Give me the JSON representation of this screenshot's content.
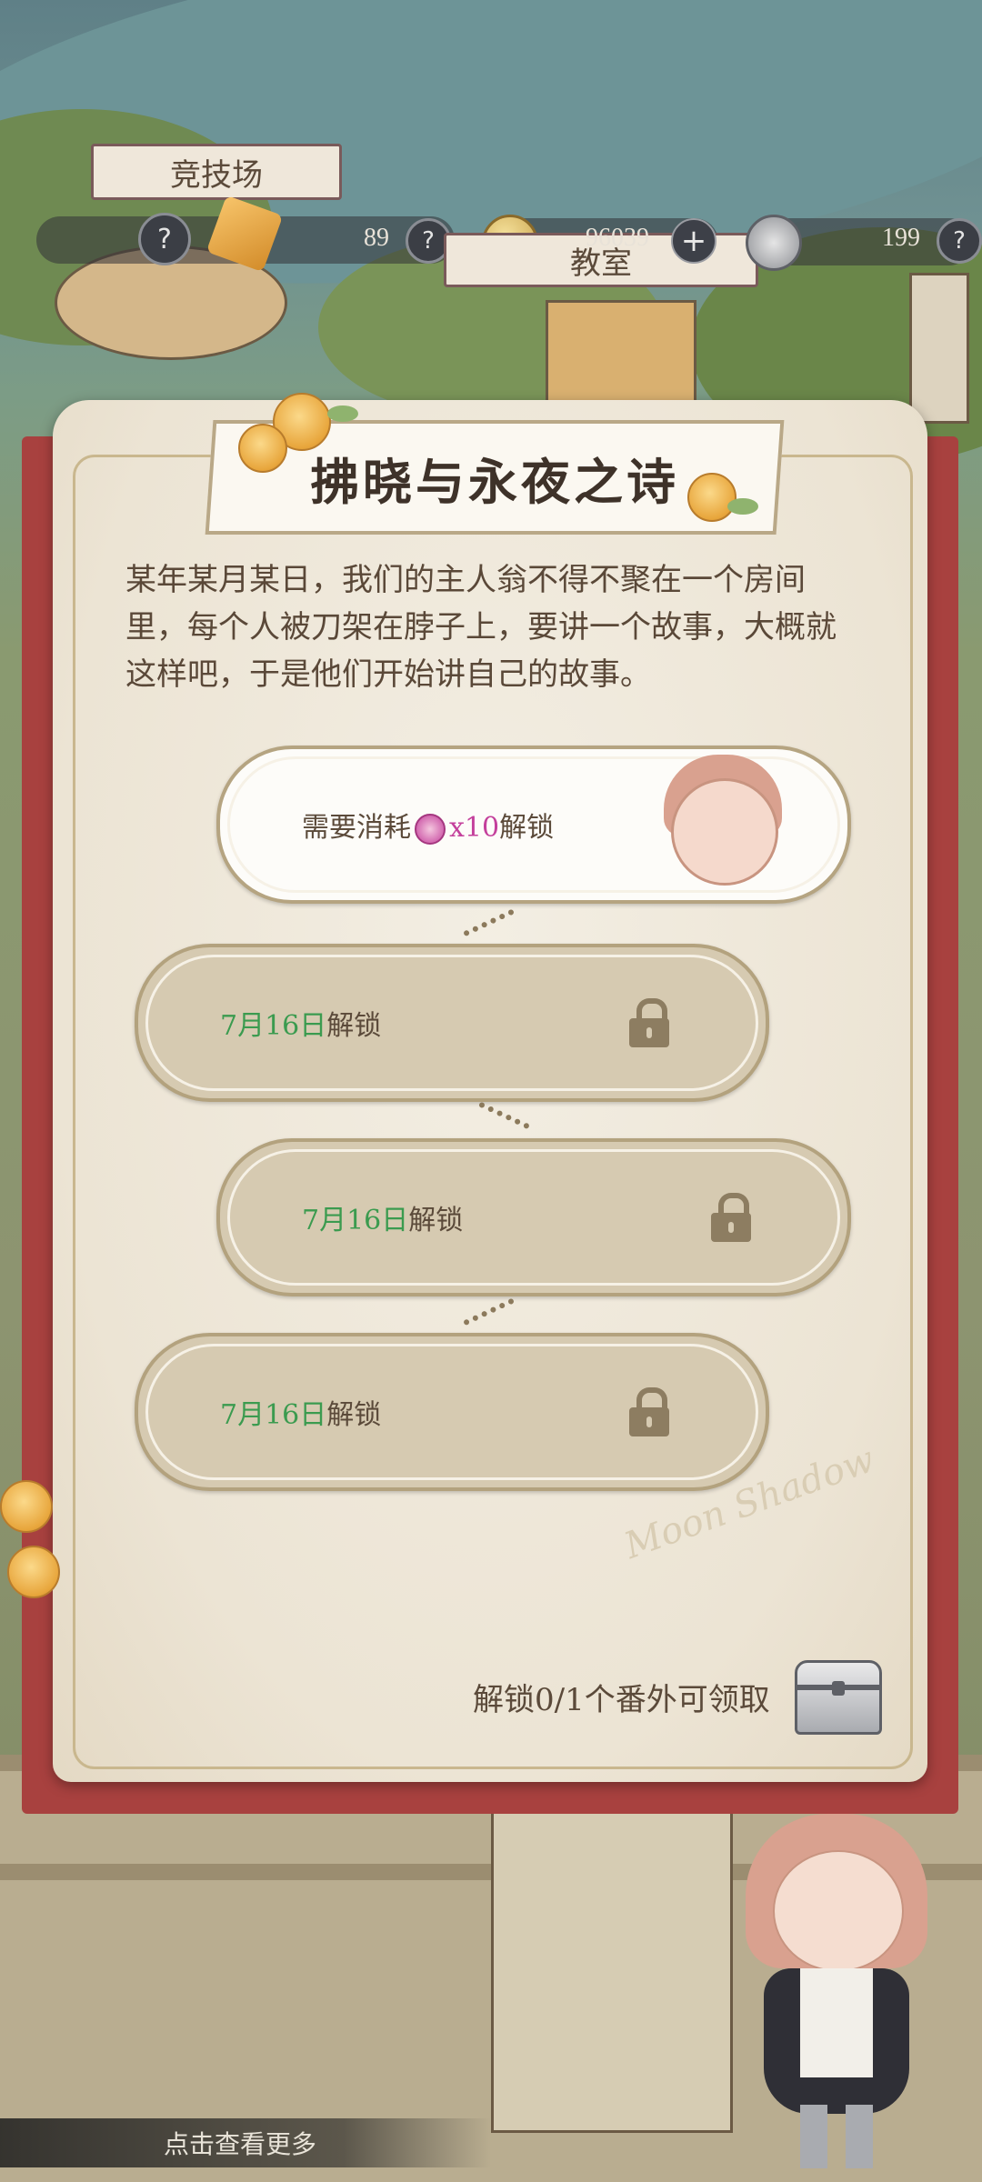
{
  "map": {
    "arena_label": "竞技场",
    "classroom_label": "教室"
  },
  "resources": {
    "item1_count": "89",
    "gold_count": "96039",
    "ticket_count": "199",
    "help_symbol": "?",
    "add_symbol": "+"
  },
  "panel": {
    "title": "拂晓与永夜之诗",
    "description": "某年某月某日，我们的主人翁不得不聚在一个房间里，每个人被刀架在脖子上，要讲一个故事，大概就这样吧，于是他们开始讲自己的故事。",
    "chapters": [
      {
        "prefix": "需要消耗",
        "cost": "x10",
        "suffix": "解锁",
        "state": "available",
        "icon": "key-icon"
      },
      {
        "date": "7月16日",
        "suffix": "解锁",
        "state": "locked",
        "icon": "lock-icon"
      },
      {
        "date": "7月16日",
        "suffix": "解锁",
        "state": "locked",
        "icon": "lock-icon"
      },
      {
        "date": "7月16日",
        "suffix": "解锁",
        "state": "locked",
        "icon": "lock-icon"
      }
    ],
    "reward_text": "解锁0/1个番外可领取",
    "signature": "Moon Shadow"
  },
  "bottom": {
    "more_label": "点击查看更多"
  },
  "colors": {
    "accent_red": "#a8413f",
    "date_green": "#3b9b4f",
    "cost_magenta": "#c4409c",
    "locked_fill": "#d6cab1"
  }
}
